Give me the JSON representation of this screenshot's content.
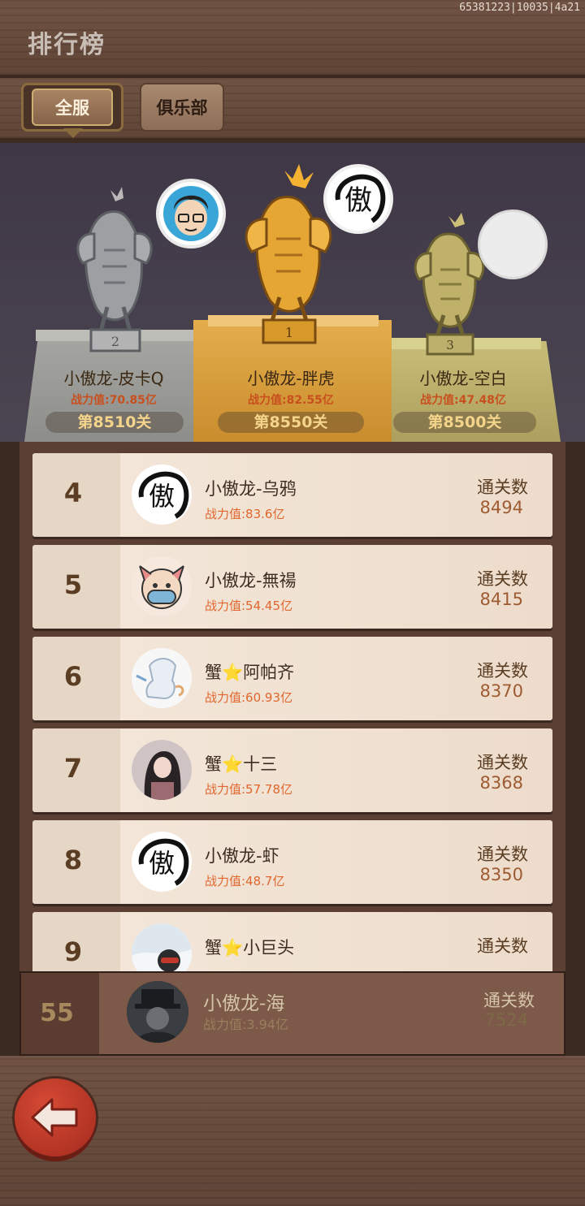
{
  "build_id": "65381223|10035|4a21",
  "page_title": "排行榜",
  "tabs": {
    "all": "全服",
    "club": "俱乐部"
  },
  "podium": [
    {
      "place": "2",
      "name": "小傲龙-皮卡Q",
      "power": "战力值:70.85亿",
      "level": "第8510关"
    },
    {
      "place": "1",
      "name": "小傲龙-胖虎",
      "power": "战力值:82.55亿",
      "level": "第8550关"
    },
    {
      "place": "3",
      "name": "小傲龙-空白",
      "power": "战力值:47.48亿",
      "level": "第8500关"
    }
  ],
  "list": [
    {
      "rank": "4",
      "name": "小傲龙-乌鸦",
      "power": "战力值:83.6亿",
      "stat_label": "通关数",
      "stat": "8494"
    },
    {
      "rank": "5",
      "name": "小傲龙-無禓",
      "power": "战力值:54.45亿",
      "stat_label": "通关数",
      "stat": "8415"
    },
    {
      "rank": "6",
      "name": "蟹⭐阿帕齐",
      "power": "战力值:60.93亿",
      "stat_label": "通关数",
      "stat": "8370"
    },
    {
      "rank": "7",
      "name": "蟹⭐十三",
      "power": "战力值:57.78亿",
      "stat_label": "通关数",
      "stat": "8368"
    },
    {
      "rank": "8",
      "name": "小傲龙-虾",
      "power": "战力值:48.7亿",
      "stat_label": "通关数",
      "stat": "8350"
    },
    {
      "rank": "9",
      "name": "蟹⭐小巨头",
      "power": "",
      "stat_label": "通关数",
      "stat": ""
    }
  ],
  "me": {
    "rank": "55",
    "name": "小傲龙-海",
    "power": "战力值:3.94亿",
    "stat_label": "通关数",
    "stat": "7524"
  },
  "icons": {
    "back": "back-arrow-icon"
  }
}
